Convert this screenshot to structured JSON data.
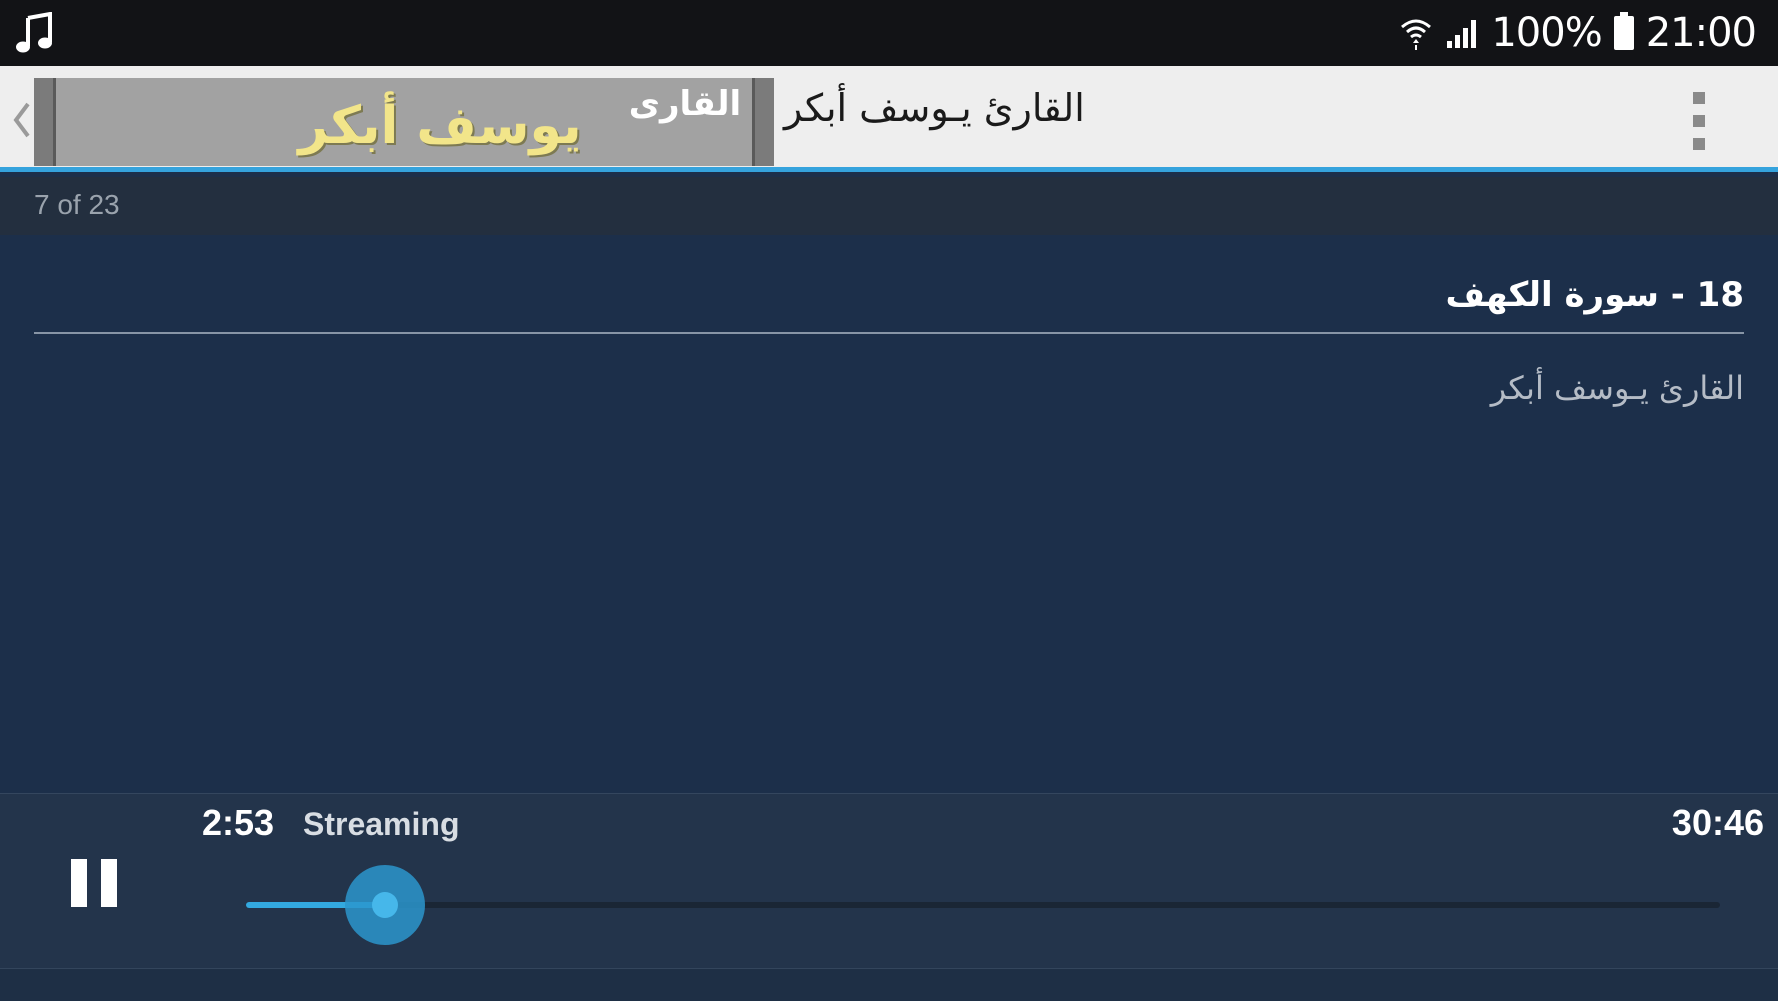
{
  "status_bar": {
    "notification_icon": "music-note-icon",
    "wifi_icon": "wifi-icon",
    "signal_icon": "signal-icon",
    "battery_icon": "battery-icon",
    "battery_percent": "100%",
    "time": "21:00"
  },
  "action_bar": {
    "back_icon": "chevron-left-icon",
    "logo": {
      "small_text": "القارى",
      "large_text": "يوسف أبكر"
    },
    "title": "القارئ يـوسف أبكر",
    "overflow_icon": "more-vertical-icon"
  },
  "playlist": {
    "position_label": "7 of 23"
  },
  "track": {
    "title": "18 - سورة الكهف",
    "artist": "القارئ يـوسف أبكر"
  },
  "player": {
    "pause_icon": "pause-icon",
    "elapsed": "2:53",
    "status": "Streaming",
    "duration": "30:46",
    "progress_fraction": 0.094,
    "accent_color": "#33a9e0"
  },
  "colors": {
    "status_bar_bg": "#121316",
    "action_bar_bg": "#eeeeee",
    "accent": "#35a3dd",
    "content_bg": "#1c2f4a",
    "player_bg": "#23344b"
  }
}
